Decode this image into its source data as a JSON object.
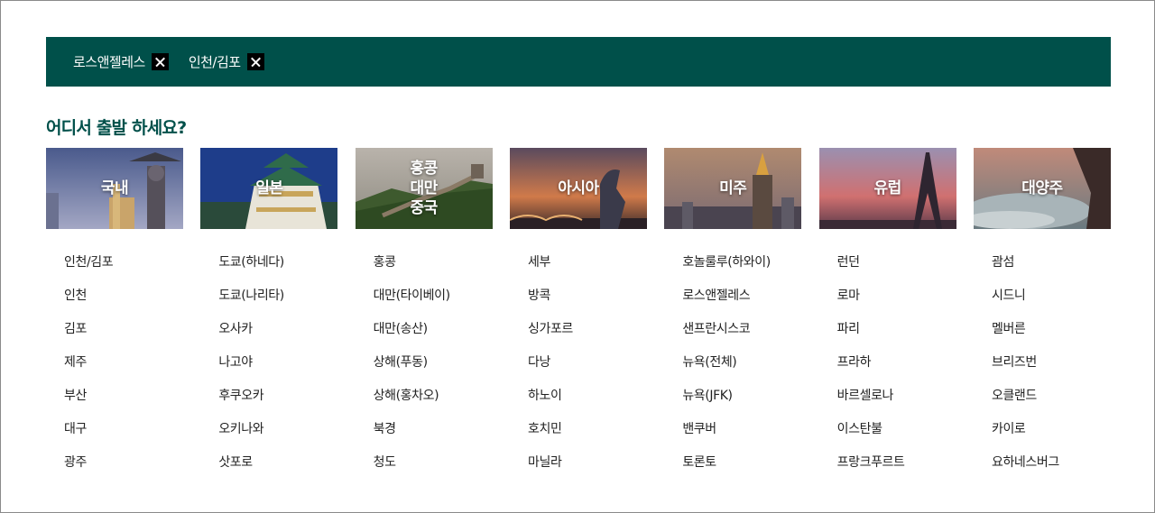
{
  "selected": [
    {
      "label": "로스앤젤레스"
    },
    {
      "label": "인천/김포"
    }
  ],
  "question": "어디서 출발 하세요?",
  "regions": [
    {
      "title": "국내",
      "cities": [
        "인천/김포",
        "인천",
        "김포",
        "제주",
        "부산",
        "대구",
        "광주"
      ]
    },
    {
      "title": "일본",
      "cities": [
        "도쿄(하네다)",
        "도쿄(나리타)",
        "오사카",
        "나고야",
        "후쿠오카",
        "오키나와",
        "삿포로"
      ]
    },
    {
      "title": "홍콩\n대만\n중국",
      "cities": [
        "홍콩",
        "대만(타이베이)",
        "대만(송산)",
        "상해(푸동)",
        "상해(홍차오)",
        "북경",
        "청도"
      ]
    },
    {
      "title": "아시아",
      "cities": [
        "세부",
        "방콕",
        "싱가포르",
        "다낭",
        "하노이",
        "호치민",
        "마닐라"
      ]
    },
    {
      "title": "미주",
      "cities": [
        "호놀룰루(하와이)",
        "로스앤젤레스",
        "샌프란시스코",
        "뉴욕(전체)",
        "뉴욕(JFK)",
        "밴쿠버",
        "토론토"
      ]
    },
    {
      "title": "유럽",
      "cities": [
        "런던",
        "로마",
        "파리",
        "프라하",
        "바르셀로나",
        "이스탄불",
        "프랑크푸르트"
      ]
    },
    {
      "title": "대양주",
      "cities": [
        "괌섬",
        "시드니",
        "멜버른",
        "브리즈번",
        "오클랜드",
        "카이로",
        "요하네스버그"
      ]
    }
  ],
  "colors": {
    "accent": "#00504a",
    "close_button": "#000000"
  }
}
